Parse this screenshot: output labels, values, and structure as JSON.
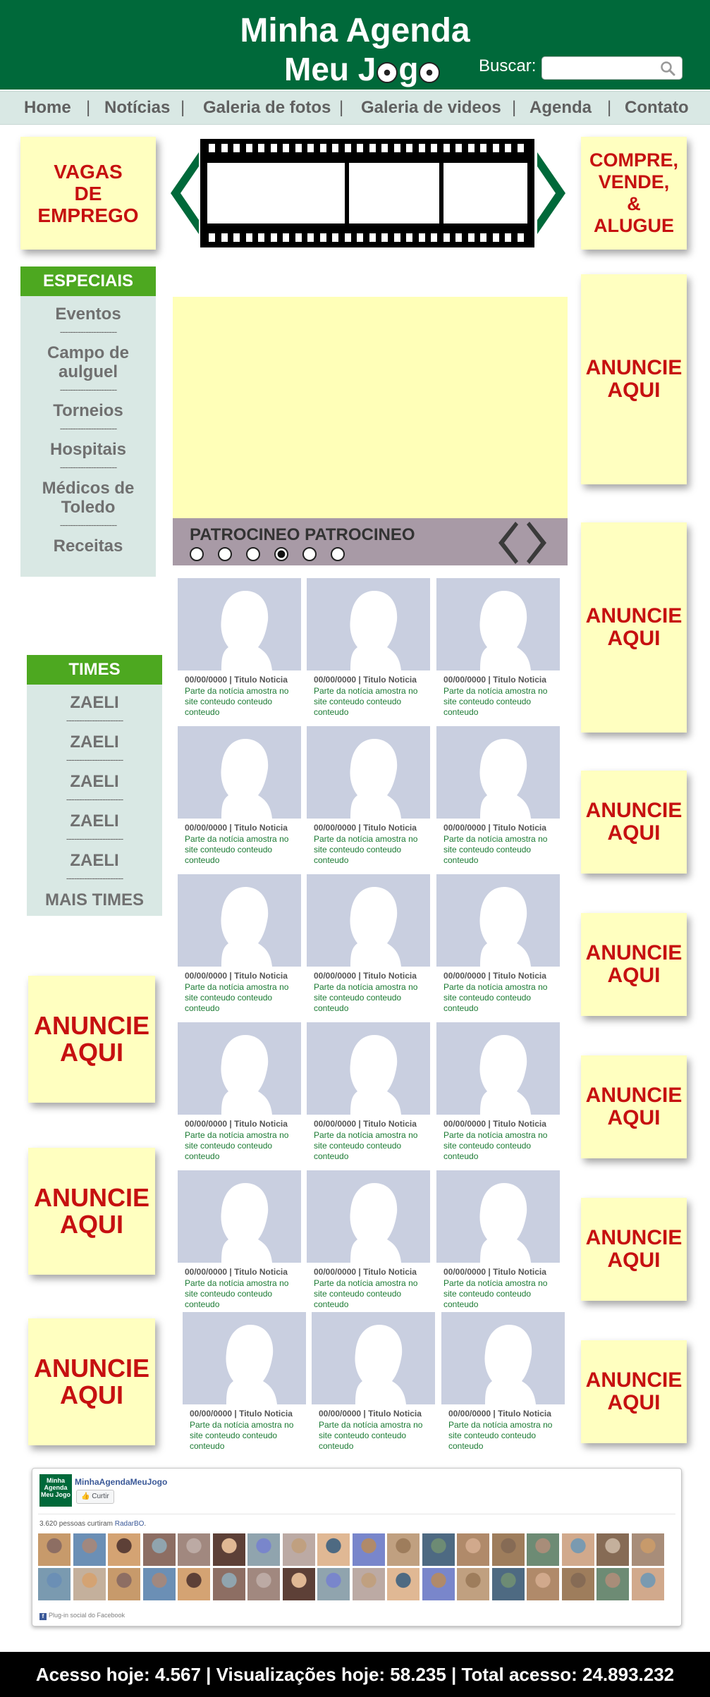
{
  "header": {
    "title_line1": "Minha Agenda",
    "title_line2_a": "Meu J",
    "title_line2_b": "g",
    "search_label": "Buscar:",
    "search_value": "",
    "search_placeholder": ""
  },
  "nav": {
    "items": [
      "Home",
      "Notícias",
      "Galeria de fotos",
      "Galeria de videos",
      "Agenda",
      "Contato"
    ],
    "separator": "|"
  },
  "top_ads": {
    "left": [
      "VAGAS",
      "DE",
      "EMPREGO"
    ],
    "right": [
      "COMPRE,",
      "VENDE,",
      "&",
      "ALUGUE"
    ]
  },
  "especiais": {
    "title": "ESPECIAIS",
    "items": [
      "Eventos",
      "Campo de aulguel",
      "Torneios",
      "Hospitais",
      "Médicos de Toledo",
      "Receitas"
    ],
    "separator": "----------------------"
  },
  "times": {
    "title": "TIMES",
    "items": [
      "ZAELI",
      "ZAELI",
      "ZAELI",
      "ZAELI",
      "ZAELI",
      "MAIS TIMES"
    ],
    "separator": "----------------------"
  },
  "ad_text": [
    "ANUNCIE",
    "AQUI"
  ],
  "banner": {
    "caption": "PATROCINEO PATROCINEO",
    "dots": 6,
    "active_dot": 4
  },
  "news": {
    "date": "00/00/0000",
    "sep": "|",
    "title": "Titulo Noticia",
    "excerpt": "Parte da notícia amostra no site conteudo conteudo conteudo"
  },
  "facebook": {
    "page_name": "MinhaAgendaMeuJogo",
    "logo_text": "Minha Agenda Meu Jogo",
    "like_label": "Curtir",
    "count_text": "3.620 pessoas curtiram",
    "count_link": "RadarBO",
    "footer": "Plug-in social do Facebook"
  },
  "footer": {
    "stats": "Acesso hoje: 4.567 | Visualizações hoje: 58.235 | Total acesso: 24.893.232"
  },
  "colors": {
    "header_green": "#00693a",
    "nav_bg": "#d9e8e4",
    "ad_yellow": "#ffffc0",
    "ad_red": "#c61010",
    "menu_green": "#4da820",
    "banner_bar": "#a89aa6",
    "thumb_bg": "#c9cfe0"
  }
}
